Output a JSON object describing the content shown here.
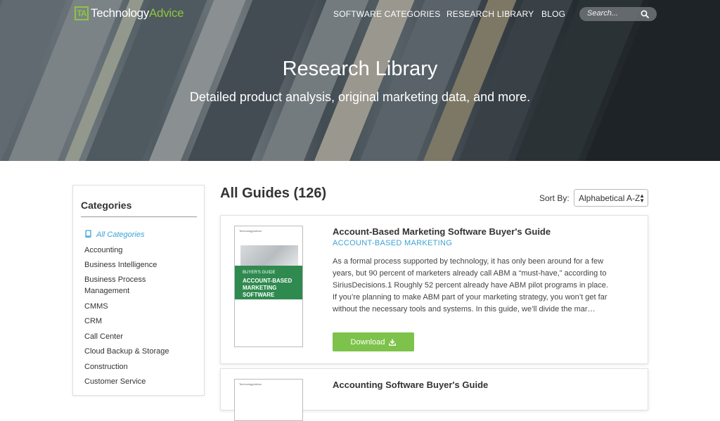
{
  "header": {
    "logo": {
      "mark": "TA",
      "word_main": "Technology",
      "word_accent": "Advice"
    },
    "nav": [
      "SOFTWARE CATEGORIES",
      "RESEARCH LIBRARY",
      "BLOG"
    ],
    "search": {
      "placeholder": "Search..."
    }
  },
  "hero": {
    "title": "Research Library",
    "subtitle": "Detailed product analysis, original marketing data, and more."
  },
  "sidebar": {
    "title": "Categories",
    "items": [
      {
        "label": "All Categories"
      },
      {
        "label": "Accounting"
      },
      {
        "label": "Business Intelligence"
      },
      {
        "label": "Business Process Management"
      },
      {
        "label": "CMMS"
      },
      {
        "label": "CRM"
      },
      {
        "label": "Call Center"
      },
      {
        "label": "Cloud Backup & Storage"
      },
      {
        "label": "Construction"
      },
      {
        "label": "Customer Service"
      }
    ]
  },
  "main": {
    "title": "All Guides (126)",
    "sort": {
      "label": "Sort By:",
      "selected": "Alphabetical A-Z"
    },
    "guides": [
      {
        "title": "Account-Based Marketing Software Buyer's Guide",
        "category": "ACCOUNT-BASED MARKETING",
        "description": "As a formal process supported by technology, it has only been around for a few years, but 90 percent of marketers already call ABM a “must-have,” according to SiriusDecisions.1 Roughly 52 percent already have ABM pilot programs in place. If you’re planning to make ABM part of your marketing strategy, you won’t get far without the necessary tools and systems. In this guide, we’ll divide the mar…",
        "cover": {
          "small": "BUYER'S GUIDE",
          "big": "ACCOUNT-BASED MARKETING SOFTWARE",
          "logo": "TechnologyAdvice"
        },
        "button": "Download"
      },
      {
        "title": "Accounting Software Buyer's Guide",
        "cover": {
          "logo": "TechnologyAdvice"
        }
      }
    ]
  },
  "colors": {
    "accent_green": "#7dc24a",
    "link_blue": "#3aa3d6",
    "logo_green": "#8cc63f",
    "cover_green": "#2f8a4f"
  }
}
